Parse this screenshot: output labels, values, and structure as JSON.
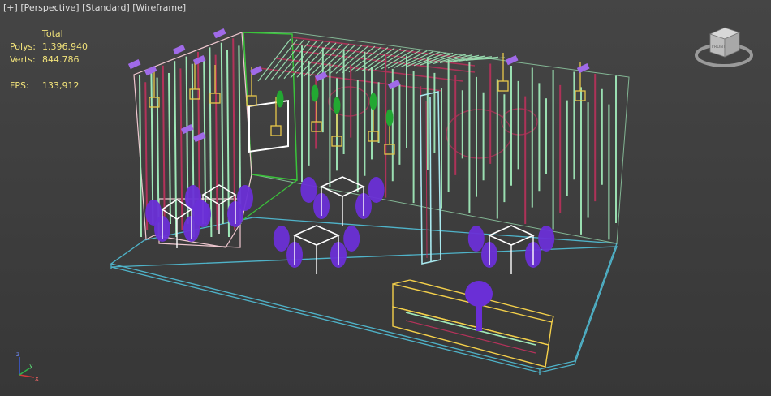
{
  "viewport": {
    "label_plus": "[+]",
    "label_view": "[Perspective]",
    "label_shading": "[Standard]",
    "label_mode": "[Wireframe]"
  },
  "stats": {
    "header": "Total",
    "polys_label": "Polys:",
    "polys_value": "1.396.940",
    "verts_label": "Verts:",
    "verts_value": "844.786",
    "fps_label": "FPS:",
    "fps_value": "133,912"
  },
  "viewcube": {
    "face_label": "FRONT"
  },
  "axis": {
    "x": "x",
    "y": "y",
    "z": "z"
  },
  "colors": {
    "background": "#3d3d3d",
    "stats_text": "#f2e37a",
    "floor": "#4fb3c9",
    "panel_mint": "#9fe8b8",
    "panel_red": "#b4325a",
    "furniture": "#6a2fd6",
    "lights": "#e8c84a",
    "plants": "#22a832",
    "column": "#a8e8ee",
    "counter": "#f4d04a",
    "roof_outline": "#3ac43a"
  }
}
